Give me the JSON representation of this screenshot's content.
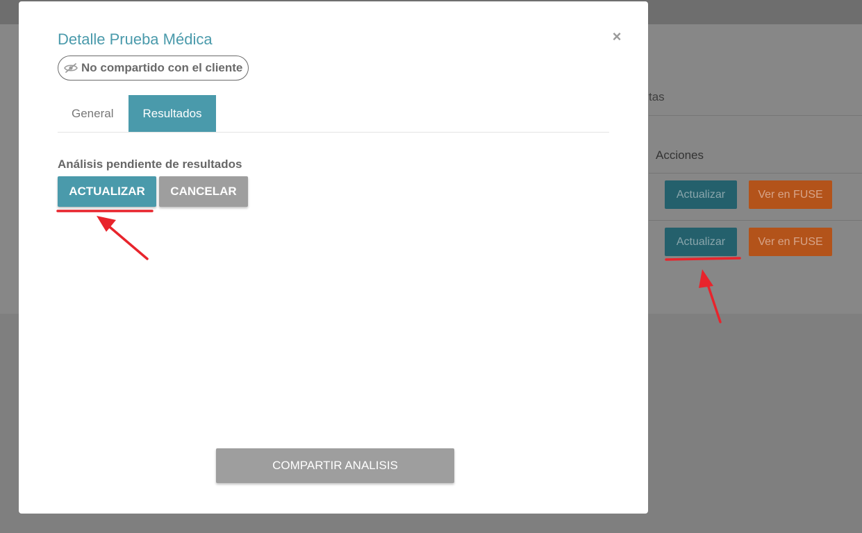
{
  "background": {
    "tab_partial": "tas",
    "table_header_actions": "Acciones",
    "rows": [
      {
        "update_label": "Actualizar",
        "fuse_label": "Ver en FUSE"
      },
      {
        "update_label": "Actualizar",
        "fuse_label": "Ver en FUSE"
      }
    ]
  },
  "modal": {
    "title": "Detalle Prueba Médica",
    "close_symbol": "×",
    "share_status": {
      "icon": "eye-slash-icon",
      "label": "No compartido con el cliente"
    },
    "tabs": [
      {
        "label": "General",
        "active": false
      },
      {
        "label": "Resultados",
        "active": true
      }
    ],
    "results": {
      "status_text": "Análisis pendiente de resultados",
      "update_button": "ACTUALIZAR",
      "cancel_button": "CANCELAR"
    },
    "share_button": "COMPARTIR ANALISIS"
  },
  "colors": {
    "accent": "#4a9aab",
    "annotation_red": "#e8242c",
    "fuse_orange": "#b3531a"
  }
}
